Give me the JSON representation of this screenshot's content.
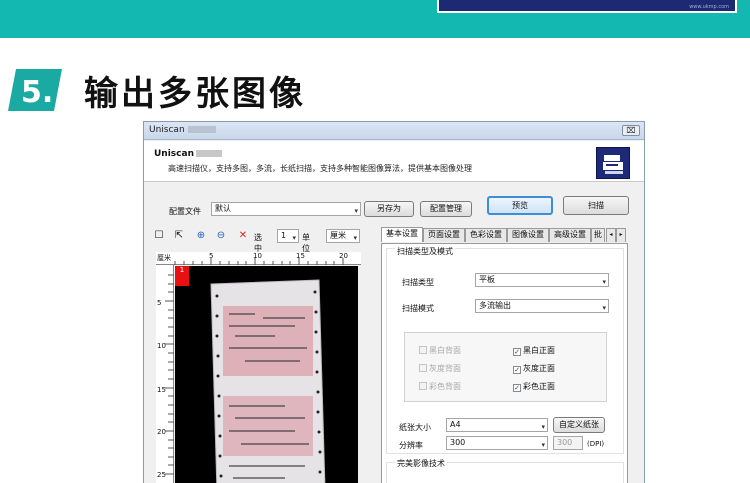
{
  "banner": {
    "small_text": "www.ukmp.com"
  },
  "section": {
    "number": "5.",
    "title": "输出多张图像"
  },
  "window": {
    "title": "Uniscan",
    "close_label": "⌧",
    "app_name": "Uniscan",
    "description": "高速扫描仪，支持多图，多流，长纸扫描，支持多种智能图像算法，提供基本图像处理"
  },
  "config": {
    "label": "配置文件",
    "value": "默认",
    "save_as": "另存为",
    "manage": "配置管理",
    "preview": "预览",
    "scan": "扫描"
  },
  "toolbar": {
    "select_label": "选中",
    "select_value": "1",
    "unit_label": "单位",
    "unit_value": "厘米"
  },
  "ruler": {
    "unit": "厘米",
    "top_ticks": [
      "5",
      "10",
      "15",
      "20"
    ],
    "left_ticks": [
      "5",
      "10",
      "15",
      "20",
      "25"
    ]
  },
  "preview": {
    "page_number": "1"
  },
  "tabs": [
    {
      "label": "基本设置"
    },
    {
      "label": "页面设置"
    },
    {
      "label": "色彩设置"
    },
    {
      "label": "图像设置"
    },
    {
      "label": "高级设置"
    },
    {
      "label": "批"
    }
  ],
  "basic": {
    "group_title": "扫描类型及模式",
    "scan_type_label": "扫描类型",
    "scan_type_value": "平板",
    "scan_mode_label": "扫描模式",
    "scan_mode_value": "多流输出",
    "options": {
      "bw_back": "黑白背面",
      "gray_back": "灰度背面",
      "color_back": "彩色背面",
      "bw_front": "黑白正面",
      "gray_front": "灰度正面",
      "color_front": "彩色正面"
    },
    "paper_size_label": "纸张大小",
    "paper_size_value": "A4",
    "custom_paper": "自定义纸张",
    "resolution_label": "分辨率",
    "resolution_value": "300",
    "resolution_custom": "300",
    "dpi": "(DPI)",
    "perfect_title": "完美影像技术"
  }
}
